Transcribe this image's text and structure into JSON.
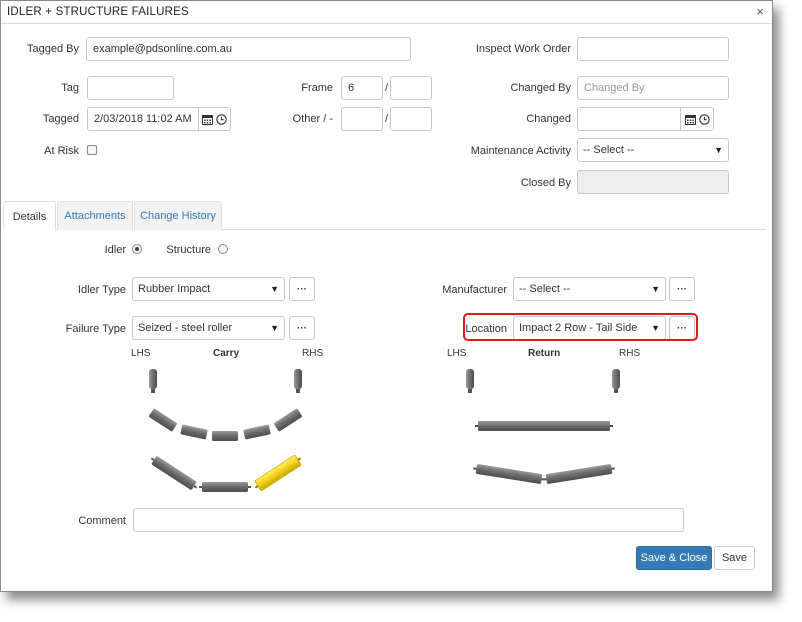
{
  "dialog": {
    "title": "IDLER + STRUCTURE FAILURES",
    "close_symbol": "×"
  },
  "form": {
    "tagged_by": {
      "label": "Tagged By",
      "value": "example@pdsonline.com.au"
    },
    "inspect_work_order": {
      "label": "Inspect Work Order",
      "value": ""
    },
    "tag": {
      "label": "Tag",
      "value": ""
    },
    "frame": {
      "label": "Frame",
      "value": "6",
      "value2": "",
      "separator": "/"
    },
    "changed_by": {
      "label": "Changed By",
      "placeholder": "Changed By"
    },
    "tagged": {
      "label": "Tagged",
      "value": "2/03/2018 11:02 AM"
    },
    "other": {
      "label": "Other / -",
      "value": "",
      "value2": "",
      "separator": "/"
    },
    "changed": {
      "label": "Changed",
      "value": ""
    },
    "at_risk": {
      "label": "At Risk",
      "checked": false
    },
    "maintenance_activity": {
      "label": "Maintenance Activity",
      "value": "-- Select --"
    },
    "closed_by": {
      "label": "Closed By",
      "value": ""
    }
  },
  "tabs": [
    {
      "label": "Details",
      "active": true
    },
    {
      "label": "Attachments",
      "active": false
    },
    {
      "label": "Change History",
      "active": false
    }
  ],
  "details": {
    "idler_radio": {
      "label": "Idler",
      "selected": true
    },
    "structure_radio": {
      "label": "Structure",
      "selected": false
    },
    "idler_type": {
      "label": "Idler Type",
      "value": "Rubber Impact"
    },
    "failure_type": {
      "label": "Failure Type",
      "value": "Seized - steel roller"
    },
    "manufacturer": {
      "label": "Manufacturer",
      "value": "-- Select --"
    },
    "location": {
      "label": "Location",
      "value": "Impact 2 Row - Tail Side"
    },
    "ellipsis_label": "···",
    "carry": {
      "lhs": "LHS",
      "title": "Carry",
      "rhs": "RHS"
    },
    "return": {
      "lhs": "LHS",
      "title": "Return",
      "rhs": "RHS"
    },
    "comment": {
      "label": "Comment",
      "value": ""
    }
  },
  "buttons": {
    "save_close": "Save & Close",
    "save": "Save"
  },
  "colors": {
    "primary": "#337ab7",
    "highlight": "#e5191b",
    "roller": "#6f6f6f",
    "roller_failed": "#f2d01a"
  },
  "icons": {
    "calendar": "calendar-icon",
    "clock": "clock-icon",
    "caret": "caret-down-icon"
  }
}
